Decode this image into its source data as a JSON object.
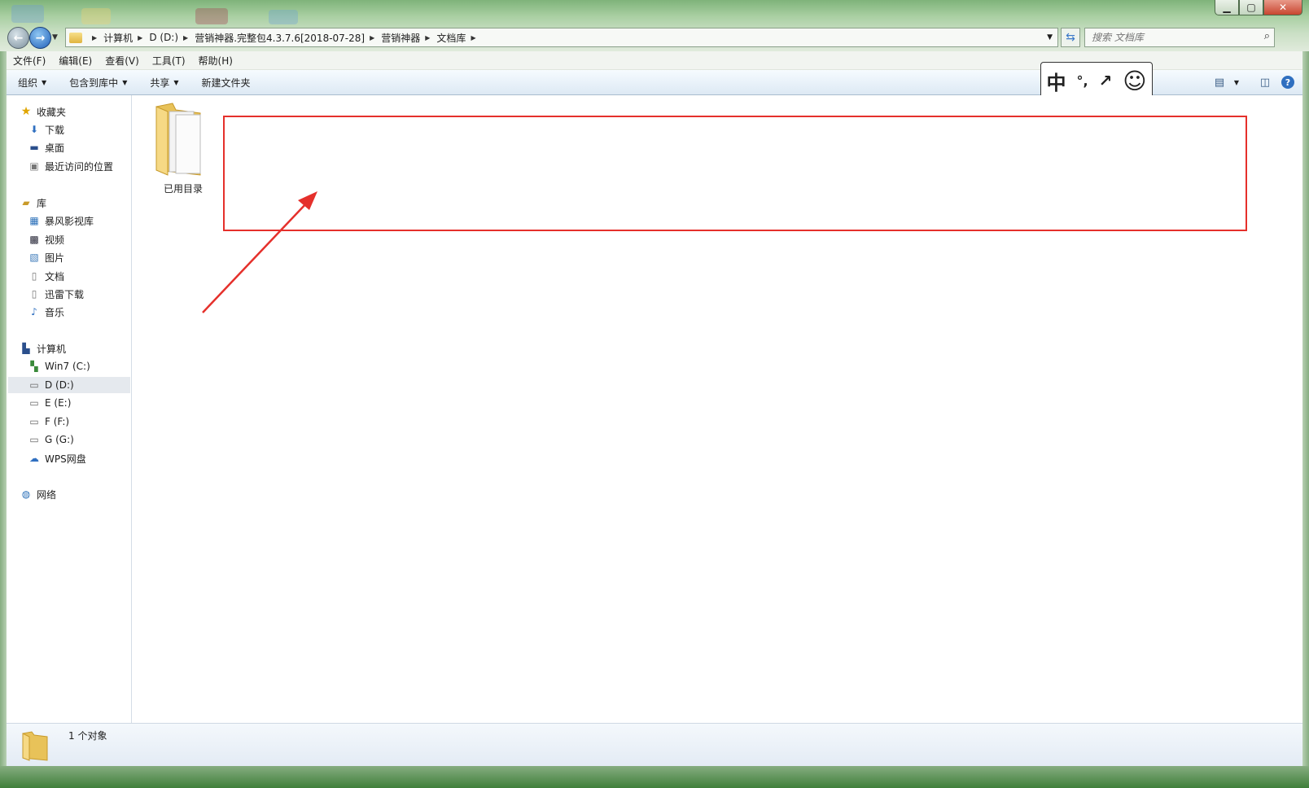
{
  "address": {
    "crumbs": [
      "计算机",
      "D (D:)",
      "营销神器.完整包4.3.7.6[2018-07-28]",
      "营销神器",
      "文档库"
    ]
  },
  "search": {
    "placeholder": "搜索 文档库"
  },
  "menubar": [
    "文件(F)",
    "编辑(E)",
    "查看(V)",
    "工具(T)",
    "帮助(H)"
  ],
  "commandbar": {
    "organize": "组织",
    "include_in_library": "包含到库中",
    "share": "共享",
    "new_folder": "新建文件夹"
  },
  "ime": {
    "mode": "中",
    "punct": "°,",
    "tool": "↗",
    "face": "☺"
  },
  "navpane": {
    "favorites": {
      "label": "收藏夹",
      "items": [
        "下载",
        "桌面",
        "最近访问的位置"
      ]
    },
    "libraries": {
      "label": "库",
      "items": [
        "暴风影视库",
        "视频",
        "图片",
        "文档",
        "迅雷下载",
        "音乐"
      ]
    },
    "computer": {
      "label": "计算机",
      "items": [
        "Win7 (C:)",
        "D (D:)",
        "E (E:)",
        "F (F:)",
        "G (G:)",
        "WPS网盘"
      ]
    },
    "network": {
      "label": "网络"
    }
  },
  "content": {
    "items": [
      {
        "name": "已用目录",
        "type": "folder"
      }
    ]
  },
  "status": {
    "text": "1 个对象"
  },
  "colors": {
    "annotation": "#e5302b",
    "selected_row": "#e5e9ee"
  }
}
